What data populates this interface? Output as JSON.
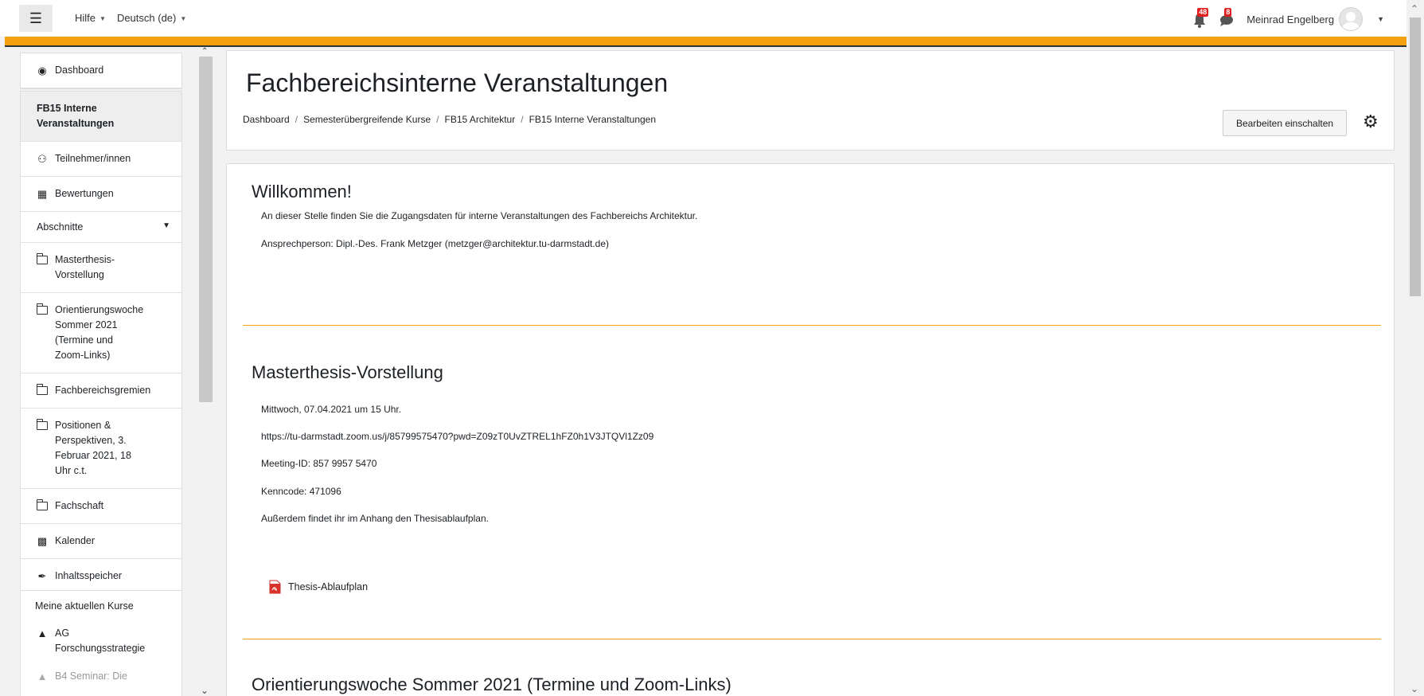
{
  "topbar": {
    "menu": [
      "Hilfe",
      "Deutsch (de)"
    ],
    "notifications_count": "48",
    "messages_count": "8",
    "user_name": "Meinrad Engelberg"
  },
  "drawer": {
    "items": [
      {
        "label": "Dashboard",
        "icon": "dashboard-icon"
      },
      {
        "label": "FB15 Interne Veranstaltungen",
        "active": true
      },
      {
        "label": "Teilnehmer/innen",
        "icon": "users-icon"
      },
      {
        "label": "Bewertungen",
        "icon": "table-icon"
      }
    ],
    "sections_label": "Abschnitte",
    "sections": [
      "Masterthesis-Vorstellung",
      "Orientierungswoche Sommer 2021 (Termine und Zoom-Links)",
      "Fachbereichsgremien",
      "Positionen & Perspektiven, 3. Februar 2021, 18 Uhr c.t.",
      "Fachschaft"
    ],
    "calendar": "Kalender",
    "content_bank": "Inhaltsspeicher",
    "my_courses_label": "Meine aktuellen Kurse",
    "courses": [
      "AG Forschungsstrategie",
      "B4 Seminar: Die"
    ]
  },
  "header": {
    "title": "Fachbereichsinterne Veranstaltungen",
    "breadcrumb": [
      "Dashboard",
      "Semesterübergreifende Kurse",
      "FB15 Architektur",
      "FB15 Interne Veranstaltungen"
    ],
    "edit_button": "Bearbeiten einschalten"
  },
  "sections": {
    "welcome": {
      "title": "Willkommen!",
      "text1": "An dieser Stelle finden Sie die Zugangsdaten für interne Veranstaltungen des Fachbereichs Architektur.",
      "text2": "Ansprechperson: Dipl.-Des. Frank Metzger (metzger@architektur.tu-darmstadt.de)"
    },
    "master": {
      "title": "Masterthesis-Vorstellung",
      "date": "Mittwoch, 07.04.2021 um 15 Uhr.",
      "link": "https://tu-darmstadt.zoom.us/j/85799575470?pwd=Z09zT0UvZTREL1hFZ0h1V3JTQVl1Zz09",
      "meeting": "Meeting-ID: 857 9957 5470",
      "code": "Kenncode: 471096",
      "note": "Außerdem findet ihr im Anhang den Thesisablaufplan.",
      "file": "Thesis-Ablaufplan"
    },
    "orientation": {
      "title": "Orientierungswoche Sommer 2021 (Termine und Zoom-Links)"
    }
  },
  "colors": {
    "accent": "#f5a10f",
    "badge": "#e02020"
  }
}
